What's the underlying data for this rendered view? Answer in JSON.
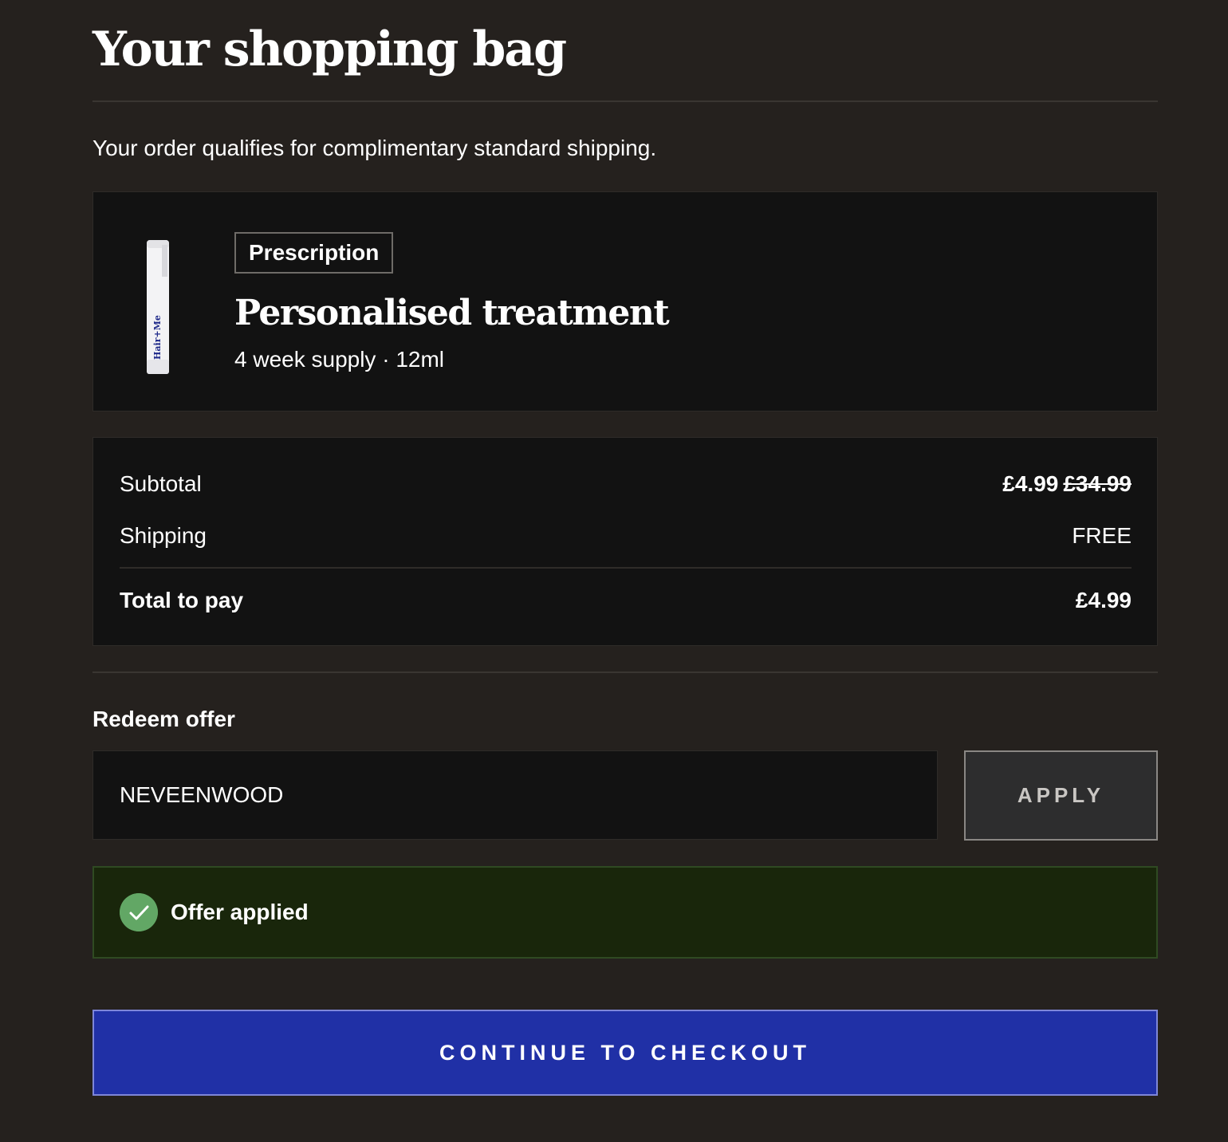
{
  "page": {
    "title": "Your shopping bag",
    "shipping_note": "Your order qualifies for complimentary standard shipping."
  },
  "product": {
    "badge": "Prescription",
    "name": "Personalised treatment",
    "meta": "4 week supply · 12ml",
    "image_brand_text": "Hair+Me"
  },
  "summary": {
    "subtotal_label": "Subtotal",
    "subtotal_price": "£4.99",
    "subtotal_original": "£34.99",
    "shipping_label": "Shipping",
    "shipping_value": "FREE",
    "total_label": "Total to pay",
    "total_value": "£4.99"
  },
  "offer": {
    "title": "Redeem offer",
    "code": "NEVEENWOOD",
    "apply_label": "APPLY",
    "success_text": "Offer applied",
    "success_icon": "check-circle-icon"
  },
  "checkout": {
    "label": "CONTINUE TO CHECKOUT"
  },
  "colors": {
    "background": "#25211e",
    "card": "#121212",
    "success_bg": "#19260b",
    "success_icon": "#62a765",
    "primary": "#2030a6"
  }
}
